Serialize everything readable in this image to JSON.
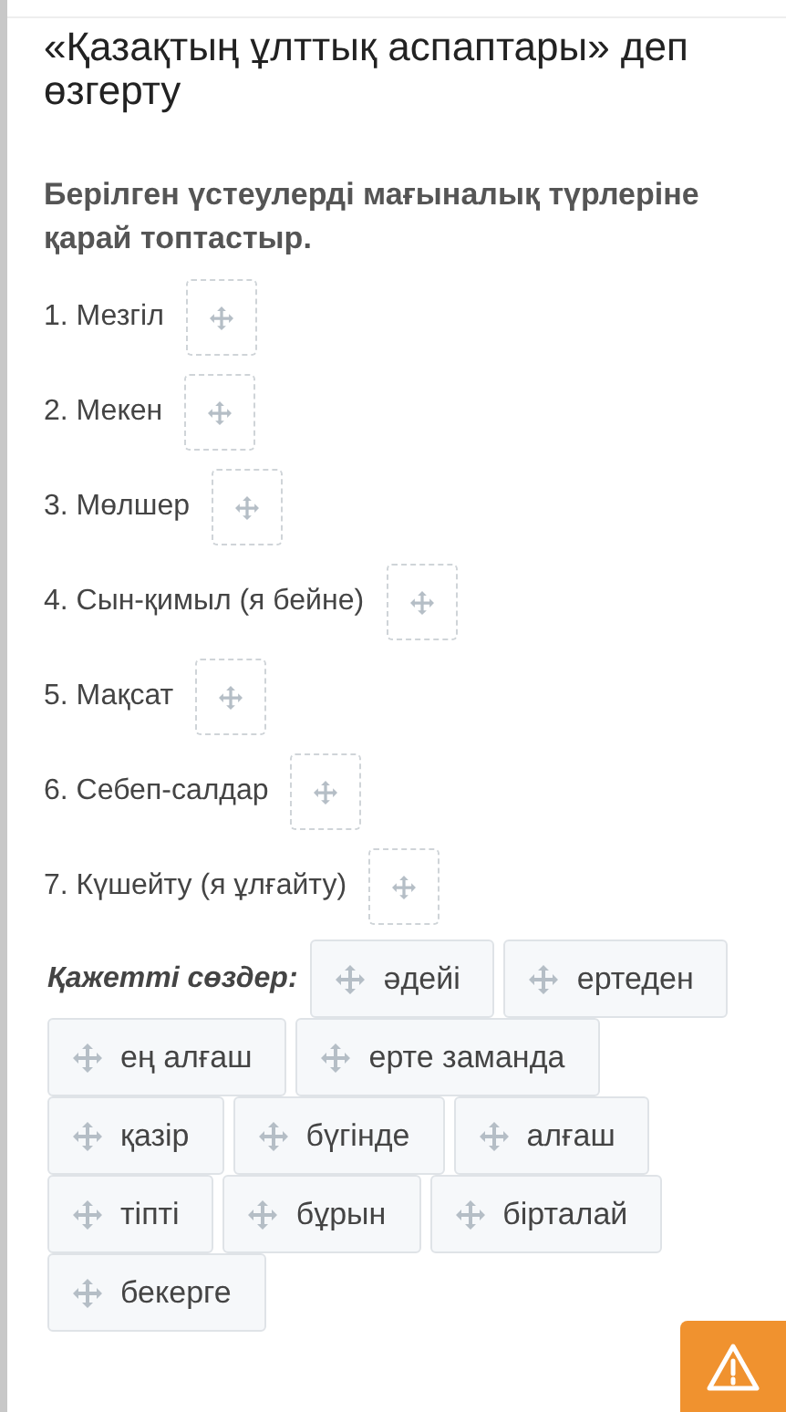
{
  "title": "«Қазақтың ұлттық аспаптары» деп өзгерту",
  "instruction": "Берілген үстеулерді мағыналық түрлеріне қарай топтастыр.",
  "categories": [
    {
      "label": "1. Мезгіл"
    },
    {
      "label": "2. Мекен"
    },
    {
      "label": "3. Мөлшер"
    },
    {
      "label": "4. Сын-қимыл (я бейне)"
    },
    {
      "label": "5. Мақсат"
    },
    {
      "label": "6. Себеп-салдар"
    },
    {
      "label": "7. Күшейту (я ұлғайту)"
    }
  ],
  "word_bank": {
    "label": "Қажетті сөздер:",
    "words": [
      "әдейі",
      "ертеден",
      "ең алғаш",
      "ерте заманда",
      "қазір",
      "бүгінде",
      "алғаш",
      "тіпті",
      "бұрын",
      "бірталай",
      "бекерге"
    ]
  }
}
